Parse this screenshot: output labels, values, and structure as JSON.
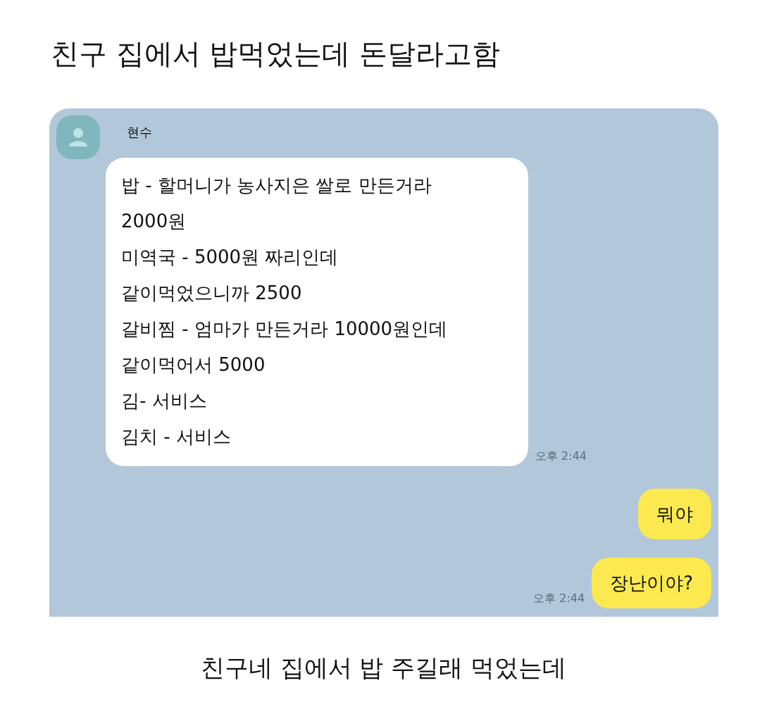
{
  "post": {
    "title": "친구 집에서 밥먹었는데 돈달라고함"
  },
  "chat": {
    "messages": [
      {
        "kind": "incoming",
        "sender": "현수",
        "lines": [
          "밥 - 할머니가 농사지은 쌀로 만든거라",
          "2000원",
          "미역국 - 5000원 짜리인데",
          "같이먹었으니까 2500",
          "갈비찜 - 엄마가 만든거라 10000원인데",
          "같이먹어서 5000",
          "김- 서비스",
          "김치 - 서비스"
        ],
        "time": "오후 2:44"
      },
      {
        "kind": "outgoing",
        "text": "뭐야"
      },
      {
        "kind": "outgoing",
        "text": "장난이야?",
        "time": "오후 2:44"
      }
    ]
  },
  "caption": "친구네 집에서 밥 주길래 먹었는데"
}
